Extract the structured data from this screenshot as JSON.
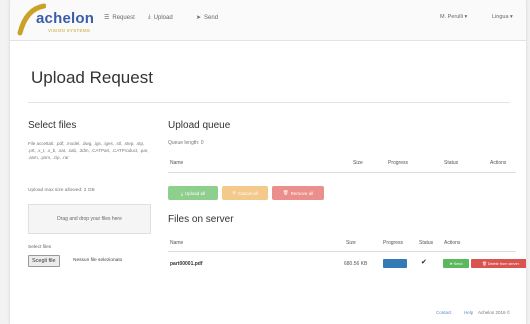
{
  "brand": {
    "name": "achelon",
    "tagline": "VISION SYSTEMS",
    "colors": {
      "blue": "#3a5da8",
      "gold": "#c9a227"
    }
  },
  "nav": {
    "request": "Request",
    "upload": "Upload",
    "send": "Send",
    "user": "M. Perulli ▾",
    "language": "Lingua ▾"
  },
  "page_title": "Upload Request",
  "select_files": {
    "heading": "Select files",
    "allowed_extensions": "File accettati: .pdf, .model, .dwg, .igs, .iges, .stl, .step, .stp, .prt, .x_t, .x_b, .sat, .sab, .3dm, .CATPart, .CATProduct, .par, .asm, .psm, .zip, .rar",
    "max_size": "Upload max size allowed: 2 GB",
    "dropzone": "Drag and drop your files here",
    "select_label": "Select files",
    "choose_button": "Scegli file",
    "no_file": "Nessun file selezionato"
  },
  "upload_queue": {
    "heading": "Upload queue",
    "queue_length": "Queue length: 0",
    "columns": [
      "Name",
      "Size",
      "Progress",
      "Status",
      "Actions"
    ],
    "buttons": {
      "upload_all": "Upload all",
      "cancel_all": "Cancel all",
      "remove_all": "Remove all"
    }
  },
  "files_on_server": {
    "heading": "Files on server",
    "columns": [
      "Name",
      "Size",
      "Progress",
      "Status",
      "Actions"
    ],
    "rows": [
      {
        "name": "part00001.pdf",
        "size": "680.56 KB",
        "progress": 100,
        "status": "✔",
        "send_label": "Send",
        "delete_label": "Delete from server"
      }
    ]
  },
  "footer": {
    "contact": "Contact",
    "help": "Help",
    "copyright": "Achelon 2016 ©"
  },
  "colors": {
    "success": "#5cb85c",
    "warning": "#f0ad4e",
    "danger": "#d9534f",
    "primary": "#337ab7"
  },
  "icons": {
    "request": "list-icon",
    "upload": "upload-icon",
    "send": "paper-plane-icon"
  }
}
